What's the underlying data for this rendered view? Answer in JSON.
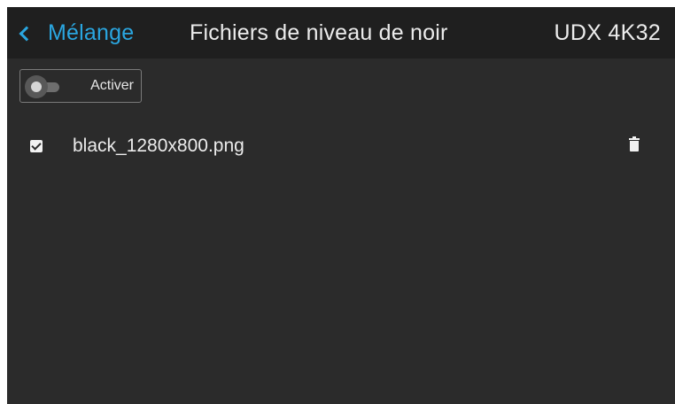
{
  "header": {
    "back_label": "Mélange",
    "title": "Fichiers de niveau de noir",
    "device": "UDX 4K32"
  },
  "toggle": {
    "label": "Activer",
    "state": "off"
  },
  "files": [
    {
      "name": "black_1280x800.png",
      "checked": true
    }
  ],
  "colors": {
    "accent": "#2aa6e0",
    "background": "#2b2b2b",
    "header_background": "#1f1f1f",
    "text": "#ececec"
  },
  "icons": {
    "back": "chevron-left-icon",
    "delete": "trash-icon",
    "checkbox": "checkbox-checked-icon"
  }
}
